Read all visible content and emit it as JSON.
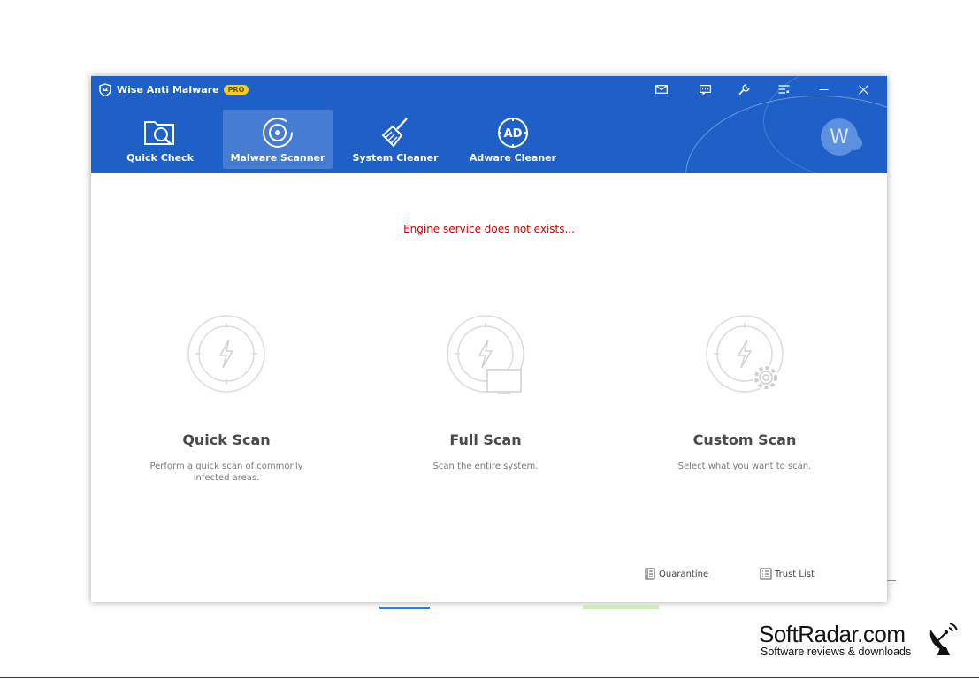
{
  "app": {
    "title": "Wise Anti Malware",
    "badge": "PRO"
  },
  "title_bar": {
    "controls": [
      {
        "name": "mail-icon"
      },
      {
        "name": "feedback-icon"
      },
      {
        "name": "tools-icon"
      },
      {
        "name": "menu-icon"
      },
      {
        "name": "minimize-icon"
      },
      {
        "name": "close-icon"
      }
    ]
  },
  "nav": {
    "tabs": [
      {
        "label": "Quick Check",
        "icon": "folder-search-icon",
        "active": false
      },
      {
        "label": "Malware Scanner",
        "icon": "scanner-target-icon",
        "active": true
      },
      {
        "label": "System Cleaner",
        "icon": "broom-icon",
        "active": false
      },
      {
        "label": "Adware Cleaner",
        "icon": "ad-block-icon",
        "active": false
      }
    ]
  },
  "avatar": {
    "letter": "W"
  },
  "main": {
    "engine_message": "Engine service does not exists...",
    "scans": [
      {
        "title": "Quick Scan",
        "desc": "Perform a quick scan of commonly infected areas.",
        "icon": "quick-scan-icon"
      },
      {
        "title": "Full Scan",
        "desc": "Scan the entire system.",
        "icon": "full-scan-icon"
      },
      {
        "title": "Custom Scan",
        "desc": "Select what you want to scan.",
        "icon": "custom-scan-icon"
      }
    ]
  },
  "footer": {
    "quarantine": "Quarantine",
    "trust_list": "Trust List"
  },
  "watermark": {
    "brand": "SoftRadar.com",
    "tagline": "Software reviews & downloads"
  },
  "colors": {
    "header_bg": "#1e60c8",
    "error_text": "#d40000",
    "pro_badge": "#f2cd2a"
  }
}
